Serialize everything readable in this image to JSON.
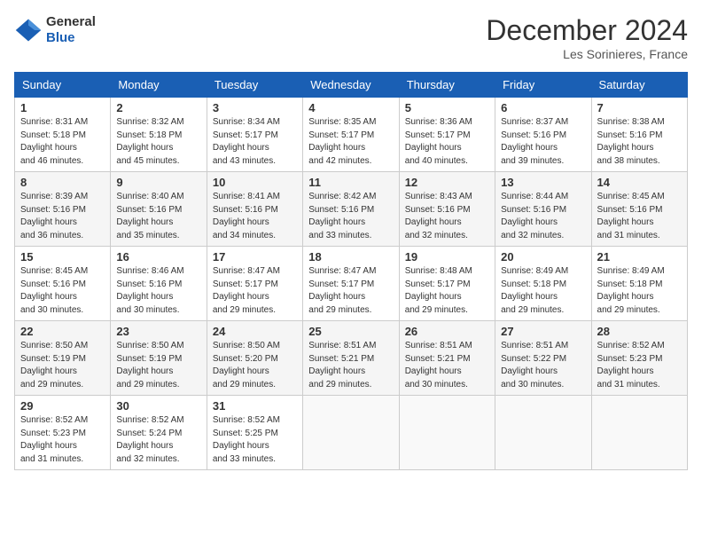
{
  "logo": {
    "line1": "General",
    "line2": "Blue"
  },
  "title": "December 2024",
  "location": "Les Sorinieres, France",
  "headers": [
    "Sunday",
    "Monday",
    "Tuesday",
    "Wednesday",
    "Thursday",
    "Friday",
    "Saturday"
  ],
  "weeks": [
    [
      {
        "day": "1",
        "sunrise": "8:31 AM",
        "sunset": "5:18 PM",
        "daylight": "8 hours and 46 minutes."
      },
      {
        "day": "2",
        "sunrise": "8:32 AM",
        "sunset": "5:18 PM",
        "daylight": "8 hours and 45 minutes."
      },
      {
        "day": "3",
        "sunrise": "8:34 AM",
        "sunset": "5:17 PM",
        "daylight": "8 hours and 43 minutes."
      },
      {
        "day": "4",
        "sunrise": "8:35 AM",
        "sunset": "5:17 PM",
        "daylight": "8 hours and 42 minutes."
      },
      {
        "day": "5",
        "sunrise": "8:36 AM",
        "sunset": "5:17 PM",
        "daylight": "8 hours and 40 minutes."
      },
      {
        "day": "6",
        "sunrise": "8:37 AM",
        "sunset": "5:16 PM",
        "daylight": "8 hours and 39 minutes."
      },
      {
        "day": "7",
        "sunrise": "8:38 AM",
        "sunset": "5:16 PM",
        "daylight": "8 hours and 38 minutes."
      }
    ],
    [
      {
        "day": "8",
        "sunrise": "8:39 AM",
        "sunset": "5:16 PM",
        "daylight": "8 hours and 36 minutes."
      },
      {
        "day": "9",
        "sunrise": "8:40 AM",
        "sunset": "5:16 PM",
        "daylight": "8 hours and 35 minutes."
      },
      {
        "day": "10",
        "sunrise": "8:41 AM",
        "sunset": "5:16 PM",
        "daylight": "8 hours and 34 minutes."
      },
      {
        "day": "11",
        "sunrise": "8:42 AM",
        "sunset": "5:16 PM",
        "daylight": "8 hours and 33 minutes."
      },
      {
        "day": "12",
        "sunrise": "8:43 AM",
        "sunset": "5:16 PM",
        "daylight": "8 hours and 32 minutes."
      },
      {
        "day": "13",
        "sunrise": "8:44 AM",
        "sunset": "5:16 PM",
        "daylight": "8 hours and 32 minutes."
      },
      {
        "day": "14",
        "sunrise": "8:45 AM",
        "sunset": "5:16 PM",
        "daylight": "8 hours and 31 minutes."
      }
    ],
    [
      {
        "day": "15",
        "sunrise": "8:45 AM",
        "sunset": "5:16 PM",
        "daylight": "8 hours and 30 minutes."
      },
      {
        "day": "16",
        "sunrise": "8:46 AM",
        "sunset": "5:16 PM",
        "daylight": "8 hours and 30 minutes."
      },
      {
        "day": "17",
        "sunrise": "8:47 AM",
        "sunset": "5:17 PM",
        "daylight": "8 hours and 29 minutes."
      },
      {
        "day": "18",
        "sunrise": "8:47 AM",
        "sunset": "5:17 PM",
        "daylight": "8 hours and 29 minutes."
      },
      {
        "day": "19",
        "sunrise": "8:48 AM",
        "sunset": "5:17 PM",
        "daylight": "8 hours and 29 minutes."
      },
      {
        "day": "20",
        "sunrise": "8:49 AM",
        "sunset": "5:18 PM",
        "daylight": "8 hours and 29 minutes."
      },
      {
        "day": "21",
        "sunrise": "8:49 AM",
        "sunset": "5:18 PM",
        "daylight": "8 hours and 29 minutes."
      }
    ],
    [
      {
        "day": "22",
        "sunrise": "8:50 AM",
        "sunset": "5:19 PM",
        "daylight": "8 hours and 29 minutes."
      },
      {
        "day": "23",
        "sunrise": "8:50 AM",
        "sunset": "5:19 PM",
        "daylight": "8 hours and 29 minutes."
      },
      {
        "day": "24",
        "sunrise": "8:50 AM",
        "sunset": "5:20 PM",
        "daylight": "8 hours and 29 minutes."
      },
      {
        "day": "25",
        "sunrise": "8:51 AM",
        "sunset": "5:21 PM",
        "daylight": "8 hours and 29 minutes."
      },
      {
        "day": "26",
        "sunrise": "8:51 AM",
        "sunset": "5:21 PM",
        "daylight": "8 hours and 30 minutes."
      },
      {
        "day": "27",
        "sunrise": "8:51 AM",
        "sunset": "5:22 PM",
        "daylight": "8 hours and 30 minutes."
      },
      {
        "day": "28",
        "sunrise": "8:52 AM",
        "sunset": "5:23 PM",
        "daylight": "8 hours and 31 minutes."
      }
    ],
    [
      {
        "day": "29",
        "sunrise": "8:52 AM",
        "sunset": "5:23 PM",
        "daylight": "8 hours and 31 minutes."
      },
      {
        "day": "30",
        "sunrise": "8:52 AM",
        "sunset": "5:24 PM",
        "daylight": "8 hours and 32 minutes."
      },
      {
        "day": "31",
        "sunrise": "8:52 AM",
        "sunset": "5:25 PM",
        "daylight": "8 hours and 33 minutes."
      },
      null,
      null,
      null,
      null
    ]
  ]
}
